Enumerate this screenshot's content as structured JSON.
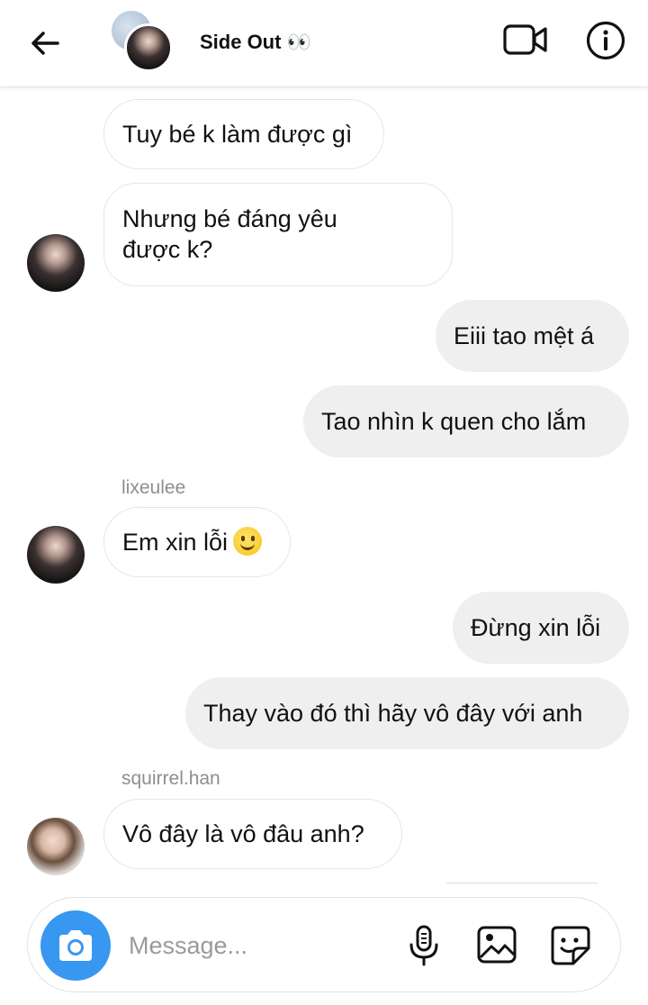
{
  "header": {
    "title": "Side Out 👀"
  },
  "messages": [
    {
      "direction": "in",
      "text": "Tuy bé k làm được gì"
    },
    {
      "direction": "in",
      "text_line1": "Nhưng bé đáng yêu",
      "text_line2": "được k?"
    },
    {
      "direction": "out",
      "text": "Eiii tao mệt á"
    },
    {
      "direction": "out",
      "text": "Tao nhìn k quen cho lắm"
    },
    {
      "direction": "in",
      "sender": "lixeulee",
      "text": "Em xin lỗi"
    },
    {
      "direction": "out",
      "text": "Đừng xin lỗi"
    },
    {
      "direction": "out",
      "text": "Thay vào đó thì hãy vô đây với anh"
    },
    {
      "direction": "in",
      "sender": "squirrel.han",
      "text": "Vô đây là vô đâu anh?"
    }
  ],
  "composer": {
    "placeholder": "Message..."
  },
  "icons": [
    "back-arrow-icon",
    "video-call-icon",
    "info-icon",
    "camera-icon",
    "microphone-icon",
    "gallery-icon",
    "sticker-icon",
    "slightly-smiling-face-emoji"
  ]
}
